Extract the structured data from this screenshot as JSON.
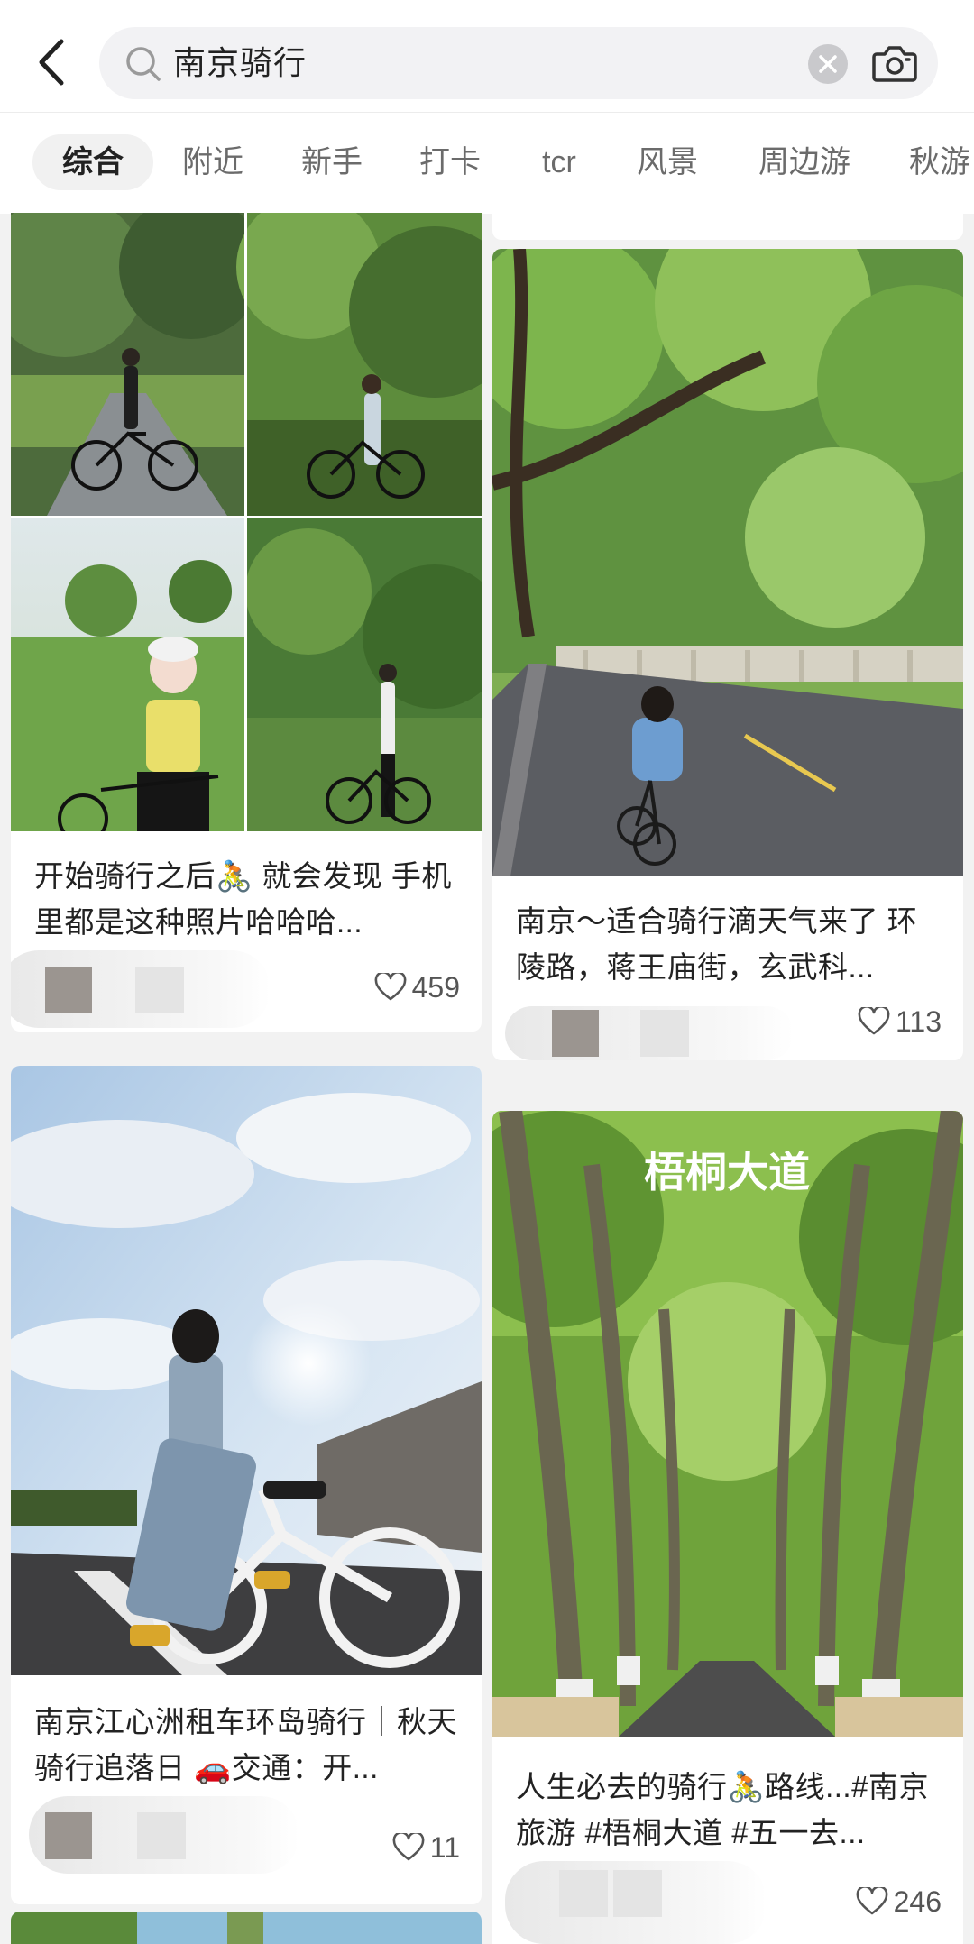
{
  "search": {
    "query": "南京骑行"
  },
  "tabs": [
    {
      "label": "综合",
      "active": true
    },
    {
      "label": "附近"
    },
    {
      "label": "新手"
    },
    {
      "label": "打卡"
    },
    {
      "label": "tcr"
    },
    {
      "label": "风景"
    },
    {
      "label": "周边游"
    },
    {
      "label": "秋游"
    }
  ],
  "posts": [
    {
      "title": "开始骑行之后🚴 就会发现 手机里都是这种照片哈哈哈...",
      "likes": "459",
      "photo": "four-photo collage of women posing with bicycles in a green park"
    },
    {
      "title": "南京～适合骑行滴天气来了 环陵路，蒋王庙街，玄武科...",
      "likes": "113",
      "photo": "woman riding a bike along a tree-lined road with stone railing"
    },
    {
      "title": "南京江心洲租车环岛骑行｜秋天骑行追落日 🚗交通：开...",
      "likes": "11",
      "photo": "woman with a white bicycle under a blue sky with sun flare"
    },
    {
      "title": "人生必去的骑行🚴路线...#南京旅游 #梧桐大道 #五一去...",
      "likes": "246",
      "photo": "avenue of tall plane trees",
      "photo_caption": "梧桐大道"
    }
  ],
  "colors": {
    "background": "#f2f2f2",
    "card": "#ffffff",
    "text_primary": "#222222",
    "text_secondary": "#6b6b6b",
    "tab_active_bg": "#f1f1f1",
    "search_bg": "#f2f2f4"
  },
  "icons": [
    "back-arrow-icon",
    "search-icon",
    "clear-icon",
    "camera-icon",
    "heart-icon"
  ]
}
